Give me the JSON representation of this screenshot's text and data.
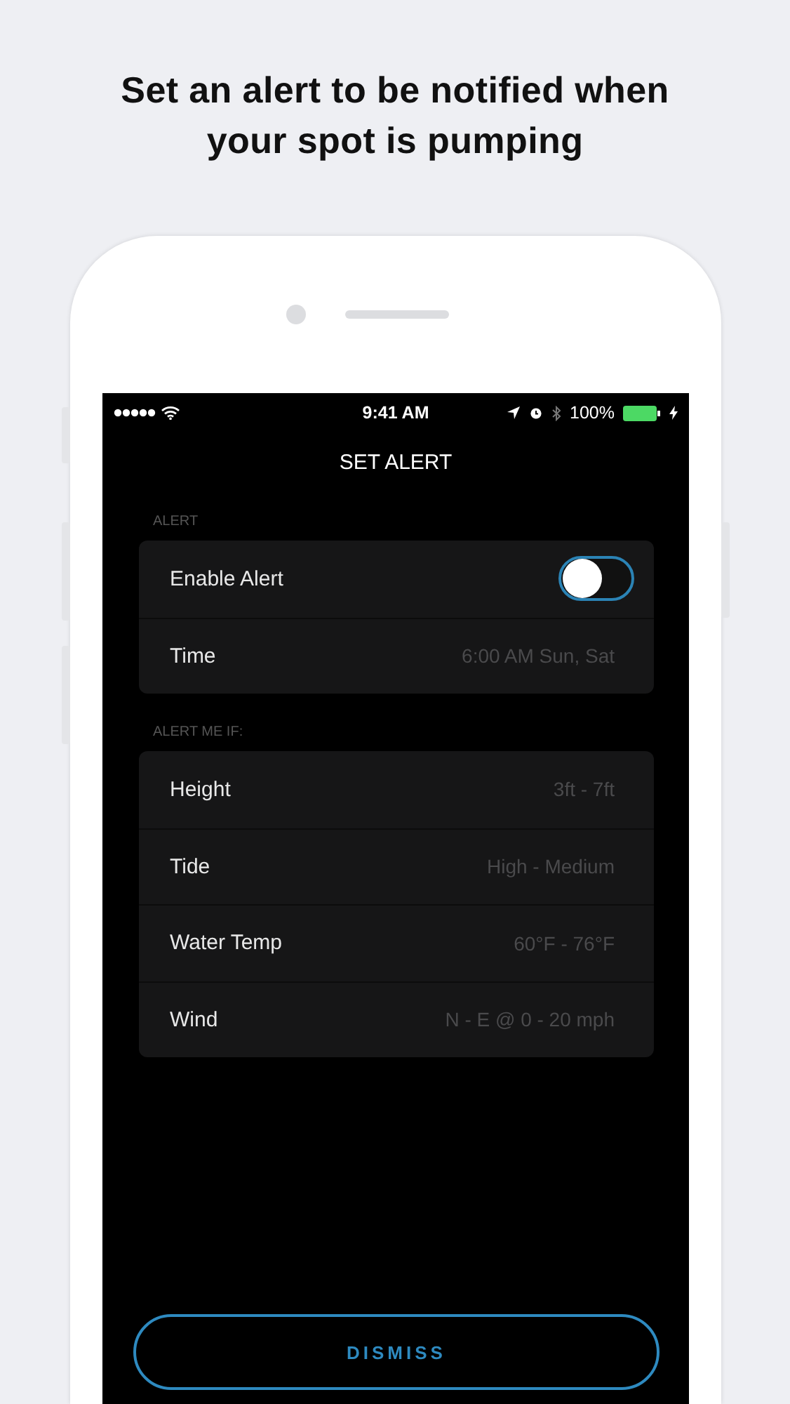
{
  "headline": "Set an alert to be notified when your spot is pumping",
  "status_bar": {
    "time": "9:41 AM",
    "battery": "100%"
  },
  "screen_title": "SET ALERT",
  "sections": [
    {
      "header": "ALERT",
      "rows": [
        {
          "kind": "toggle",
          "label": "Enable Alert",
          "on": false
        },
        {
          "kind": "value",
          "label": "Time",
          "value": "6:00 AM Sun, Sat"
        }
      ]
    },
    {
      "header": "ALERT ME IF:",
      "rows": [
        {
          "kind": "value",
          "label": "Height",
          "value": "3ft - 7ft"
        },
        {
          "kind": "value",
          "label": "Tide",
          "value": "High - Medium"
        },
        {
          "kind": "value",
          "label": "Water Temp",
          "value": "60°F - 76°F"
        },
        {
          "kind": "value",
          "label": "Wind",
          "value": "N - E @ 0 - 20 mph"
        }
      ]
    }
  ],
  "dismiss_button": "DISMISS"
}
